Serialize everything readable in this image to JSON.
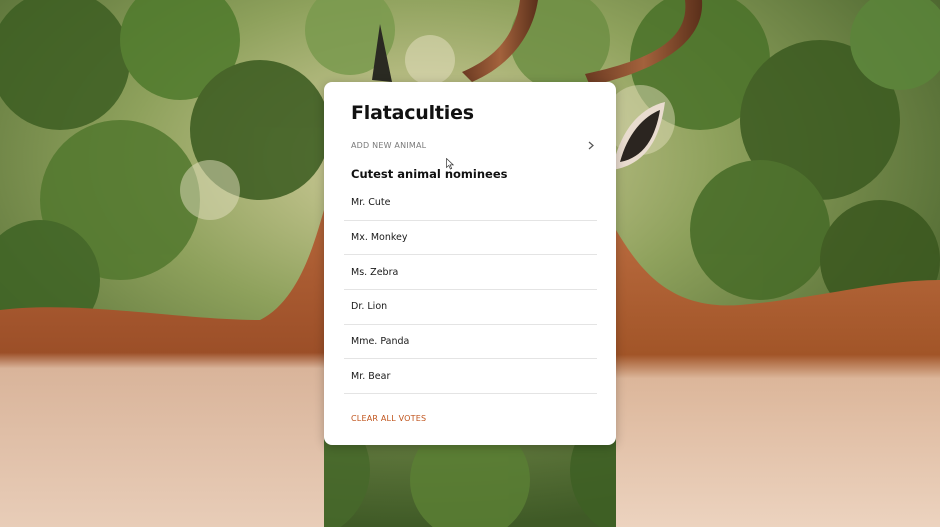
{
  "app": {
    "title": "Flataculties"
  },
  "actions": {
    "add_new_animal": "ADD NEW ANIMAL",
    "clear_all_votes": "CLEAR ALL VOTES"
  },
  "nominees_section": {
    "title": "Cutest animal nominees",
    "items": [
      {
        "name": "Mr. Cute"
      },
      {
        "name": "Mx. Monkey"
      },
      {
        "name": "Ms. Zebra"
      },
      {
        "name": "Dr. Lion"
      },
      {
        "name": "Mme. Panda"
      },
      {
        "name": "Mr. Bear"
      }
    ]
  },
  "colors": {
    "accent": "#c0541c",
    "card_bg": "#ffffff",
    "title_text": "#111111",
    "muted_text": "#7a7a7a"
  },
  "icons": {
    "add_arrow": "chevron-right-icon",
    "pointer": "mouse-cursor-icon"
  }
}
